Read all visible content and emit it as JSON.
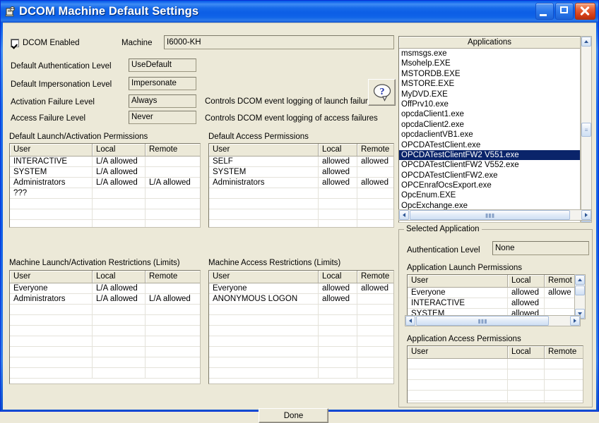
{
  "window": {
    "title": "DCOM Machine Default Settings",
    "icon": "dcom-app-icon",
    "buttons": {
      "minimize": "minimize-button",
      "maximize": "maximize-button",
      "close": "close-button"
    }
  },
  "machine": {
    "dcom_enabled_label": "DCOM Enabled",
    "dcom_enabled_checked": true,
    "machine_label": "Machine",
    "machine_value": "I6000-KH",
    "fields": [
      {
        "label": "Default Authentication Level",
        "value": "UseDefault"
      },
      {
        "label": "Default Impersonation Level",
        "value": "Impersonate"
      },
      {
        "label": "Activation Failure Level",
        "value": "Always"
      },
      {
        "label": "Access Failure Level",
        "value": "Never"
      }
    ],
    "hints": [
      "Controls DCOM event logging of launch failures",
      "Controls DCOM event logging of access failures"
    ],
    "help_icon": "help-question-icon"
  },
  "tables": {
    "columns": [
      "User",
      "Local",
      "Remote"
    ],
    "default_launch": {
      "title": "Default Launch/Activation Permissions",
      "rows": [
        [
          "INTERACTIVE",
          "L/A allowed",
          ""
        ],
        [
          "SYSTEM",
          "L/A allowed",
          ""
        ],
        [
          "Administrators",
          "L/A allowed",
          "L/A allowed"
        ],
        [
          "???",
          "",
          ""
        ],
        [
          "",
          "",
          ""
        ],
        [
          "",
          "",
          ""
        ],
        [
          "",
          "",
          ""
        ],
        [
          "",
          "",
          ""
        ],
        [
          "",
          "",
          ""
        ]
      ]
    },
    "default_access": {
      "title": "Default Access Permissions",
      "rows": [
        [
          "SELF",
          "allowed",
          "allowed"
        ],
        [
          "SYSTEM",
          "allowed",
          ""
        ],
        [
          "Administrators",
          "allowed",
          "allowed"
        ],
        [
          "",
          "",
          ""
        ],
        [
          "",
          "",
          ""
        ],
        [
          "",
          "",
          ""
        ],
        [
          "",
          "",
          ""
        ],
        [
          "",
          "",
          ""
        ],
        [
          "",
          "",
          ""
        ]
      ]
    },
    "machine_launch": {
      "title": "Machine Launch/Activation Restrictions (Limits)",
      "rows": [
        [
          "Everyone",
          "L/A allowed",
          ""
        ],
        [
          "Administrators",
          "L/A allowed",
          "L/A allowed"
        ],
        [
          "",
          "",
          ""
        ],
        [
          "",
          "",
          ""
        ],
        [
          "",
          "",
          ""
        ],
        [
          "",
          "",
          ""
        ],
        [
          "",
          "",
          ""
        ],
        [
          "",
          "",
          ""
        ]
      ]
    },
    "machine_access": {
      "title": "Machine Access Restrictions (Limits)",
      "rows": [
        [
          "Everyone",
          "allowed",
          "allowed"
        ],
        [
          "ANONYMOUS LOGON",
          "allowed",
          ""
        ],
        [
          "",
          "",
          ""
        ],
        [
          "",
          "",
          ""
        ],
        [
          "",
          "",
          ""
        ],
        [
          "",
          "",
          ""
        ],
        [
          "",
          "",
          ""
        ],
        [
          "",
          "",
          ""
        ]
      ]
    }
  },
  "applications": {
    "header": "Applications",
    "items": [
      "msmsgs.exe",
      "Msohelp.EXE",
      "MSTORDB.EXE",
      "MSTORE.EXE",
      "MyDVD.EXE",
      "OffPrv10.exe",
      "opcdaClient1.exe",
      "opcdaClient2.exe",
      "opcdaclientVB1.exe",
      "OPCDATestClient.exe",
      "OPCDATestClientFW2 V551.exe",
      "OPCDATestClientFW2 V552.exe",
      "OPCDATestClientFW2.exe",
      "OPCEnrafOcsExport.exe",
      "OpcEnum.EXE",
      "OpcExchange.exe"
    ],
    "selected": "OPCDATestClientFW2 V551.exe",
    "selected_index": 10
  },
  "selected_application": {
    "group_title": "Selected Application",
    "auth_level_label": "Authentication Level",
    "auth_level_value": "None",
    "launch": {
      "title": "Application Launch Permissions",
      "columns": [
        "User",
        "Local",
        "Remot"
      ],
      "rows": [
        [
          "Everyone",
          "allowed",
          "allowe"
        ],
        [
          "INTERACTIVE",
          "allowed",
          ""
        ],
        [
          "SYSTEM",
          "allowed",
          ""
        ]
      ]
    },
    "access": {
      "title": "Application Access Permissions",
      "columns": [
        "User",
        "Local",
        "Remote"
      ],
      "rows": [
        [
          "",
          "",
          ""
        ],
        [
          "",
          "",
          ""
        ],
        [
          "",
          "",
          ""
        ],
        [
          "",
          "",
          ""
        ],
        [
          "",
          "",
          ""
        ]
      ]
    }
  },
  "footer": {
    "done_label": "Done"
  },
  "colors": {
    "titlebar_blue": "#0a5ce8",
    "dialog_face": "#ece9d8",
    "selection_blue": "#0a246a",
    "close_red": "#d33d17"
  }
}
